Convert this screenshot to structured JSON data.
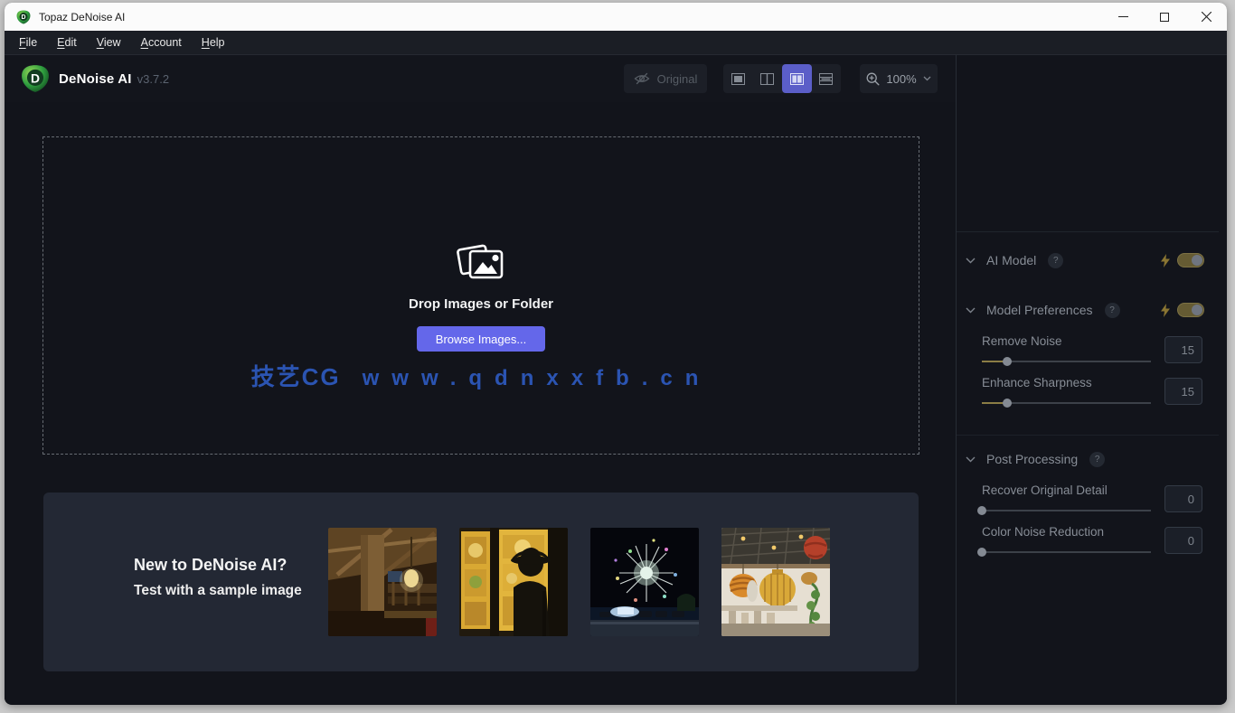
{
  "window": {
    "title": "Topaz DeNoise AI"
  },
  "menu": {
    "items": [
      {
        "label": "File"
      },
      {
        "label": "Edit"
      },
      {
        "label": "View"
      },
      {
        "label": "Account"
      },
      {
        "label": "Help"
      }
    ]
  },
  "header": {
    "app_name": "DeNoise AI",
    "version": "v3.7.2",
    "original_label": "Original",
    "zoom_level": "100%"
  },
  "view_modes": {
    "active_index": 2,
    "count": 4
  },
  "dropzone": {
    "title": "Drop Images or Folder",
    "browse_label": "Browse Images...",
    "watermark": {
      "brand": "技艺CG",
      "url": "www.qdnxxfb.cn"
    }
  },
  "samples": {
    "heading_line1": "New to DeNoise AI?",
    "heading_line2": "Test with a sample image",
    "images": [
      {
        "name": "lodge-interior"
      },
      {
        "name": "stained-glass-silhouette"
      },
      {
        "name": "fireworks-night-sky"
      },
      {
        "name": "cafe-hanging-baskets"
      }
    ]
  },
  "sidebar": {
    "sections": {
      "ai_model": {
        "label": "AI Model",
        "help": "?",
        "toggle_on": true
      },
      "model_preferences": {
        "label": "Model Preferences",
        "help": "?",
        "toggle_on": true
      },
      "post_processing": {
        "label": "Post Processing",
        "help": "?"
      }
    },
    "sliders": {
      "remove_noise": {
        "label": "Remove Noise",
        "value": 15,
        "max": 100
      },
      "enhance_sharpness": {
        "label": "Enhance Sharpness",
        "value": 15,
        "max": 100
      },
      "recover_original_detail": {
        "label": "Recover Original Detail",
        "value": 0,
        "max": 100
      },
      "color_noise_reduction": {
        "label": "Color Noise Reduction",
        "value": 0,
        "max": 100
      }
    }
  },
  "colors": {
    "active_view_accent": "#5b5ec8",
    "browse_button": "#6467ea",
    "slider_fill": "#8b7d45",
    "toggle_fill": "#655b33",
    "watermark_blue": "#2b54b2",
    "logo_green": "#3fae47"
  }
}
